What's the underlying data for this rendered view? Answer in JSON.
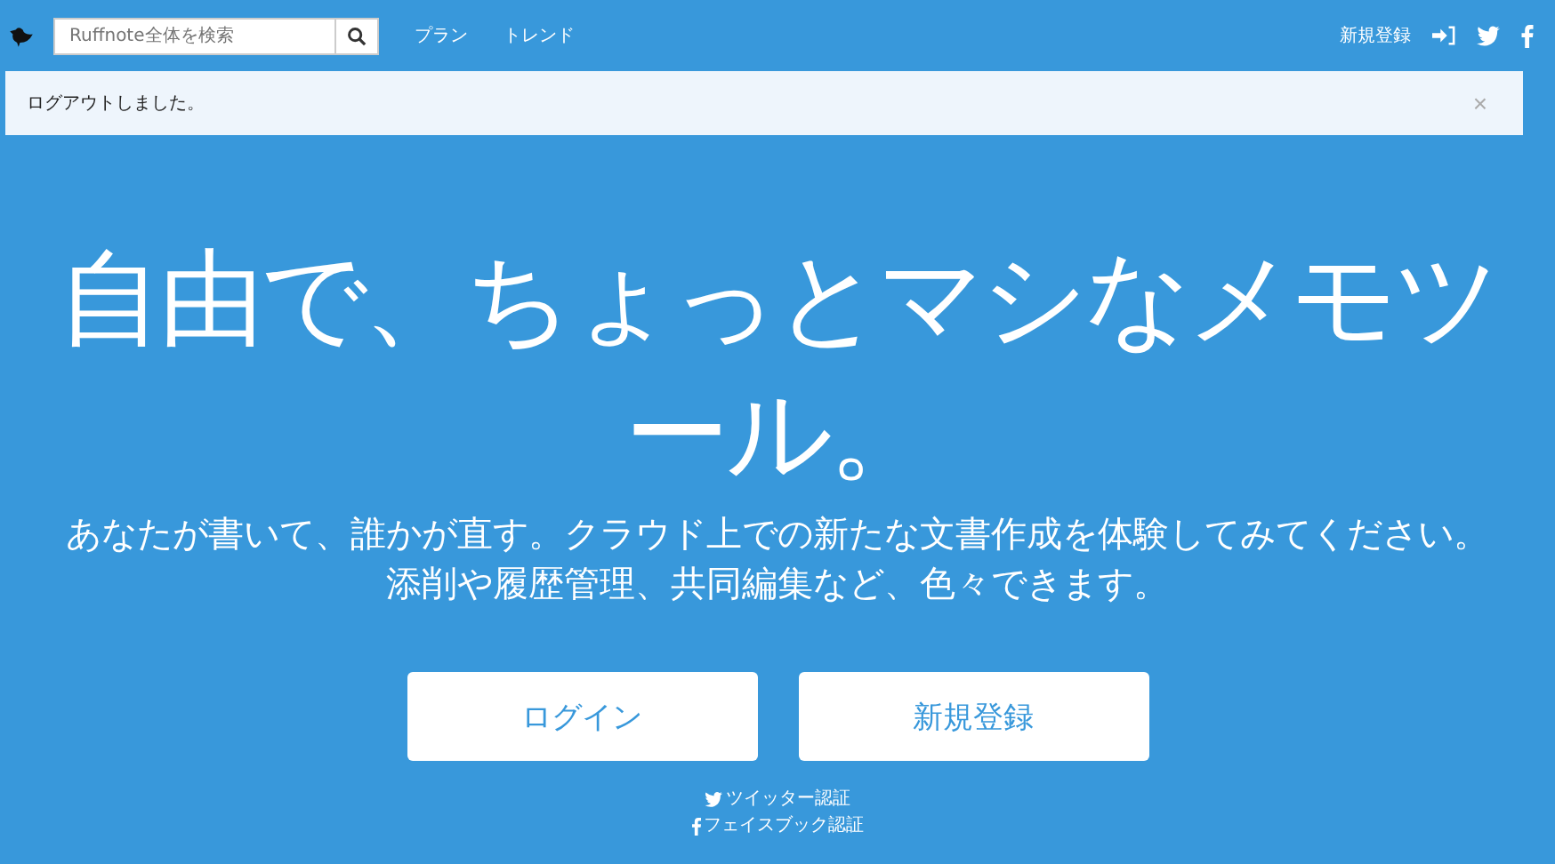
{
  "navbar": {
    "search": {
      "placeholder": "Ruffnote全体を検索"
    },
    "links": [
      "プラン",
      "トレンド"
    ],
    "signup": "新規登録"
  },
  "alert": {
    "message": "ログアウトしました。",
    "close": "×"
  },
  "hero": {
    "headline": "自由で、ちょっとマシなメモツール。",
    "subtitle": [
      "あなたが書いて、誰かが直す。クラウド上での新たな文書作成を体験してみてください。",
      "添削や履歴管理、共同編集など、色々できます。"
    ],
    "buttons": [
      "ログイン",
      "新規登録"
    ],
    "auth_links": [
      {
        "kind": "twitter",
        "label": "ツイッター認証"
      },
      {
        "kind": "facebook",
        "label": "フェイスブック認証"
      }
    ]
  }
}
